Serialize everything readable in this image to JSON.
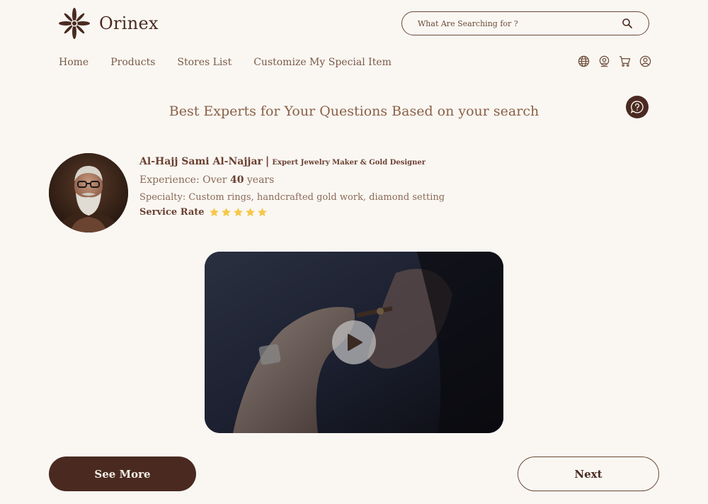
{
  "header": {
    "logo_text": "Orinex",
    "search_placeholder": "What Are Searching for ?"
  },
  "nav": {
    "items": [
      {
        "label": "Home"
      },
      {
        "label": "Products"
      },
      {
        "label": "Stores List"
      },
      {
        "label": "Customize My Special Item"
      }
    ]
  },
  "header_icons": [
    "globe-icon",
    "location-icon",
    "cart-icon",
    "user-icon"
  ],
  "help_icon": "question-chat-icon",
  "main": {
    "headline": "Best Experts for Your Questions Based on your search",
    "expert": {
      "name": "Al-Hajj Sami Al-Najjar",
      "separator": "|",
      "title": "Expert Jewelry Maker & Gold Designer",
      "experience_prefix": "Experience: Over",
      "experience_years": "40",
      "experience_suffix": "years",
      "specialty": "Specialty: Custom rings, handcrafted gold work, diamond setting",
      "rate_label": "Service Rate",
      "rating": 5,
      "rating_max": 5
    },
    "video": {
      "play_icon": "play-icon"
    }
  },
  "actions": {
    "see_more": "See More",
    "next": "Next"
  },
  "colors": {
    "background": "#faf7f3",
    "brand_dark": "#4a2a20",
    "text_brown": "#6b4a35",
    "star": "#f5c84a"
  }
}
